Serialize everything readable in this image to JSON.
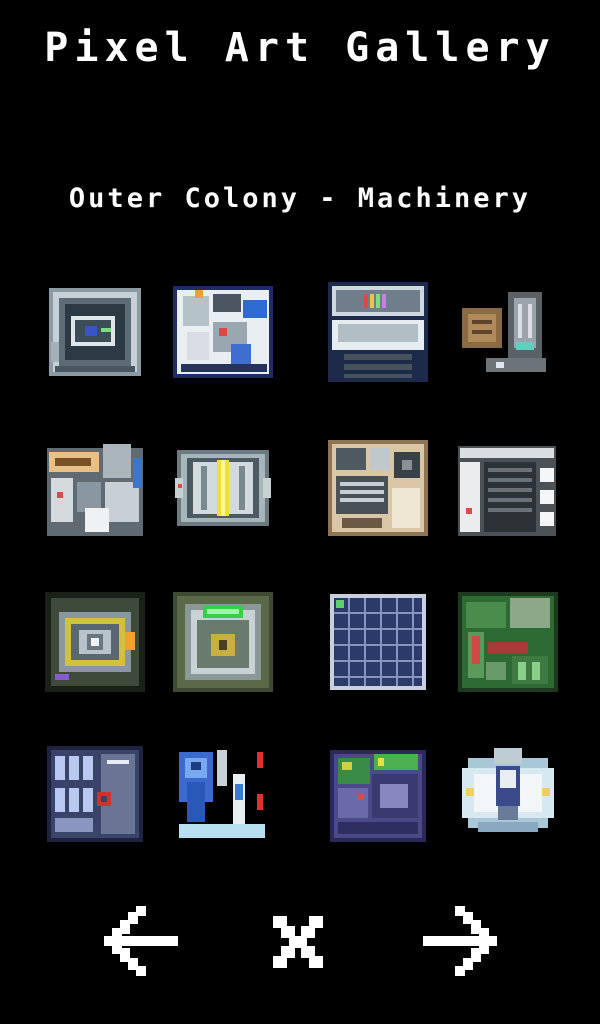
{
  "gallery": {
    "title": "Pixel Art Gallery",
    "category": "Outer Colony - Machinery"
  },
  "colors": {
    "background": "#000000",
    "text": "#ffffff"
  },
  "navigation": {
    "previous_icon": "arrow-left-icon",
    "close_icon": "close-x-icon",
    "next_icon": "arrow-right-icon"
  }
}
